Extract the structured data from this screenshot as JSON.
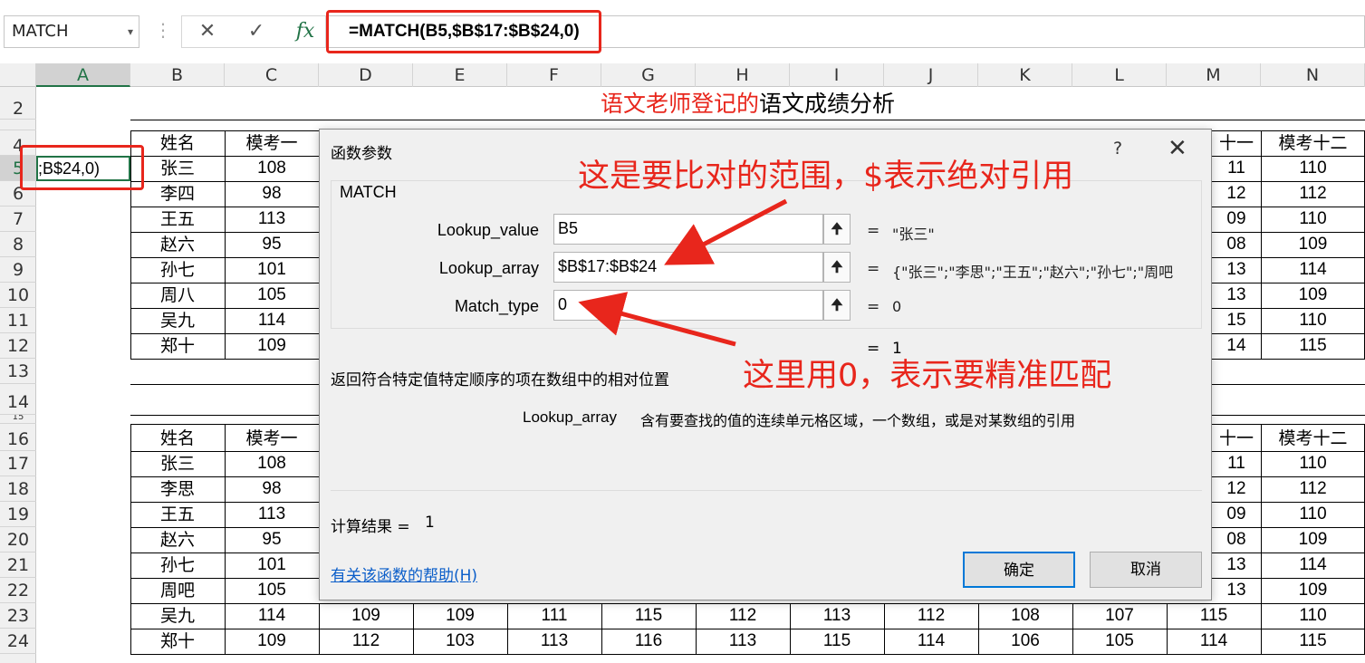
{
  "formula_bar": {
    "name_box": "MATCH",
    "cancel_icon": "✕",
    "enter_icon": "✓",
    "fx_icon": "fx",
    "formula": "=MATCH(B5,$B$17:$B$24,0)"
  },
  "columns": [
    "A",
    "B",
    "C",
    "D",
    "E",
    "F",
    "G",
    "H",
    "I",
    "J",
    "K",
    "L",
    "M",
    "N"
  ],
  "rows": [
    "2",
    "4",
    "5",
    "6",
    "7",
    "8",
    "9",
    "10",
    "11",
    "12",
    "13",
    "14",
    "15",
    "16",
    "17",
    "18",
    "19",
    "20",
    "21",
    "22",
    "23",
    "24"
  ],
  "sheet": {
    "title_red": "语文老师登记的",
    "title_black": "语文成绩分析",
    "a5_text": ";B$24,0)",
    "table1": {
      "header": [
        "姓名",
        "模考一"
      ],
      "header_right": [
        "十一",
        "模考十二"
      ],
      "rows": [
        {
          "name": "张三",
          "c": "108",
          "m": "11",
          "n": "110"
        },
        {
          "name": "李四",
          "c": "98",
          "m": "12",
          "n": "112"
        },
        {
          "name": "王五",
          "c": "113",
          "m": "09",
          "n": "110"
        },
        {
          "name": "赵六",
          "c": "95",
          "m": "08",
          "n": "109"
        },
        {
          "name": "孙七",
          "c": "101",
          "m": "13",
          "n": "114"
        },
        {
          "name": "周八",
          "c": "105",
          "m": "13",
          "n": "109"
        },
        {
          "name": "吴九",
          "c": "114",
          "m": "15",
          "n": "110"
        },
        {
          "name": "郑十",
          "c": "109",
          "m": "14",
          "n": "115"
        }
      ]
    },
    "table2": {
      "header": [
        "姓名",
        "模考一"
      ],
      "header_right": [
        "十一",
        "模考十二"
      ],
      "rows": [
        {
          "name": "张三",
          "c": "108",
          "m": "11",
          "n": "110"
        },
        {
          "name": "李思",
          "c": "98",
          "m": "12",
          "n": "112"
        },
        {
          "name": "王五",
          "c": "113",
          "m": "09",
          "n": "110"
        },
        {
          "name": "赵六",
          "c": "95",
          "m": "08",
          "n": "109"
        },
        {
          "name": "孙七",
          "c": "101",
          "m": "13",
          "n": "114"
        },
        {
          "name": "周吧",
          "c": "105",
          "m": "13",
          "n": "109"
        }
      ],
      "full_rows": [
        {
          "name": "吴九",
          "vals": [
            "114",
            "109",
            "109",
            "111",
            "115",
            "112",
            "113",
            "112",
            "108",
            "107",
            "115",
            "110"
          ]
        },
        {
          "name": "郑十",
          "vals": [
            "109",
            "112",
            "103",
            "113",
            "116",
            "113",
            "115",
            "114",
            "106",
            "105",
            "114",
            "115"
          ]
        }
      ]
    }
  },
  "dialog": {
    "title": "函数参数",
    "help_icon": "?",
    "close_icon": "✕",
    "function_name": "MATCH",
    "args": [
      {
        "label": "Lookup_value",
        "value": "B5",
        "result": "\"张三\""
      },
      {
        "label": "Lookup_array",
        "value": "$B$17:$B$24",
        "result": "{\"张三\";\"李思\";\"王五\";\"赵六\";\"孙七\";\"周吧"
      },
      {
        "label": "Match_type",
        "value": "0",
        "result": "0"
      }
    ],
    "ref_icon": "🠉",
    "total_result": "1",
    "function_desc": "返回符合特定值特定顺序的项在数组中的相对位置",
    "arg_desc_name": "Lookup_array",
    "arg_desc_text": "含有要查找的值的连续单元格区域，一个数组，或是对某数组的引用",
    "calc_label": "计算结果 =",
    "calc_value": "1",
    "help_link": "有关该函数的帮助(H)",
    "ok": "确定",
    "cancel": "取消",
    "eq": "="
  },
  "annotations": {
    "top": "这是要比对的范围，$表示绝对引用",
    "bottom": "这里用0，表示要精准匹配"
  },
  "colors": {
    "highlight": "#e8261c",
    "excel_green": "#217346",
    "link_blue": "#0b5ec9"
  }
}
